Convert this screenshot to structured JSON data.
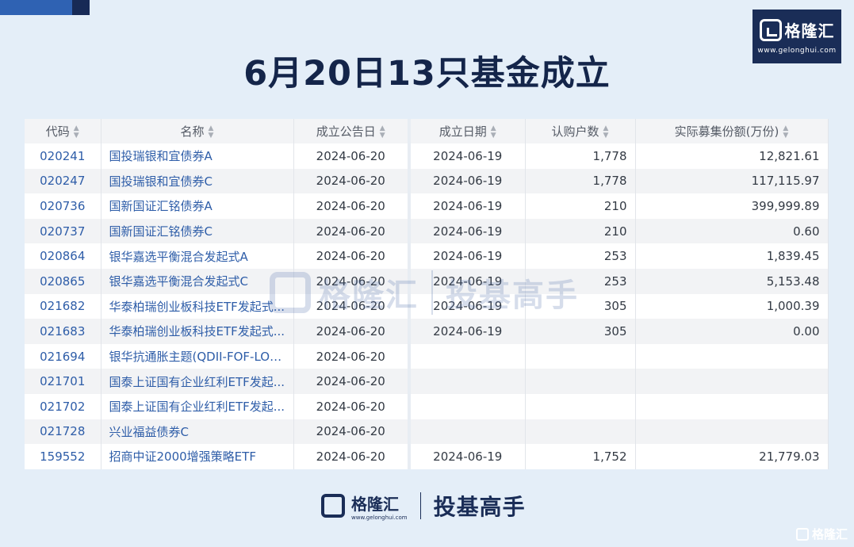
{
  "brand": {
    "name": "格隆汇",
    "url": "www.gelonghui.com",
    "slogan": "投基高手"
  },
  "title": "6月20日13只基金成立",
  "table": {
    "columns": [
      "代码",
      "名称",
      "成立公告日",
      "成立日期",
      "认购户数",
      "实际募集份额(万份)"
    ],
    "rows": [
      [
        "020241",
        "国投瑞银和宜债券A",
        "2024-06-20",
        "2024-06-19",
        "1,778",
        "12,821.61"
      ],
      [
        "020247",
        "国投瑞银和宜债券C",
        "2024-06-20",
        "2024-06-19",
        "1,778",
        "117,115.97"
      ],
      [
        "020736",
        "国新国证汇铭债券A",
        "2024-06-20",
        "2024-06-19",
        "210",
        "399,999.89"
      ],
      [
        "020737",
        "国新国证汇铭债券C",
        "2024-06-20",
        "2024-06-19",
        "210",
        "0.60"
      ],
      [
        "020864",
        "银华嘉选平衡混合发起式A",
        "2024-06-20",
        "2024-06-19",
        "253",
        "1,839.45"
      ],
      [
        "020865",
        "银华嘉选平衡混合发起式C",
        "2024-06-20",
        "2024-06-19",
        "253",
        "5,153.48"
      ],
      [
        "021682",
        "华泰柏瑞创业板科技ETF发起式...",
        "2024-06-20",
        "2024-06-19",
        "305",
        "1,000.39"
      ],
      [
        "021683",
        "华泰柏瑞创业板科技ETF发起式...",
        "2024-06-20",
        "2024-06-19",
        "305",
        "0.00"
      ],
      [
        "021694",
        "银华抗通胀主题(QDII-FOF-LOF)C",
        "2024-06-20",
        "",
        "",
        ""
      ],
      [
        "021701",
        "国泰上证国有企业红利ETF发起...",
        "2024-06-20",
        "",
        "",
        ""
      ],
      [
        "021702",
        "国泰上证国有企业红利ETF发起...",
        "2024-06-20",
        "",
        "",
        ""
      ],
      [
        "021728",
        "兴业福益债券C",
        "2024-06-20",
        "",
        "",
        ""
      ],
      [
        "159552",
        "招商中证2000增强策略ETF",
        "2024-06-20",
        "2024-06-19",
        "1,752",
        "21,779.03"
      ]
    ]
  }
}
